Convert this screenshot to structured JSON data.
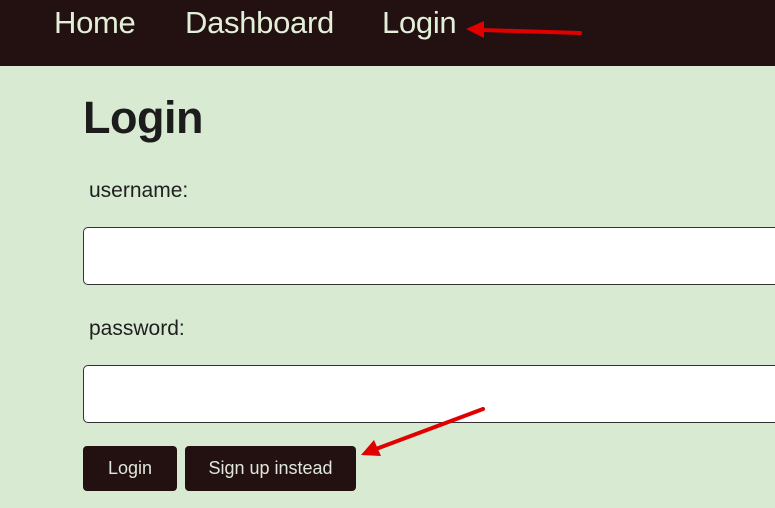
{
  "nav": {
    "links": [
      {
        "label": "Home"
      },
      {
        "label": "Dashboard"
      },
      {
        "label": "Login"
      }
    ]
  },
  "page": {
    "title": "Login"
  },
  "form": {
    "username_label": "username:",
    "username_value": "",
    "password_label": "password:",
    "password_value": "",
    "login_button": "Login",
    "signup_button": "Sign up instead"
  },
  "colors": {
    "navbar_bg": "#231010",
    "nav_text": "#e2f0d9",
    "page_bg": "#d9ead3",
    "button_bg": "#231010",
    "annotation_arrow": "#e00000"
  }
}
